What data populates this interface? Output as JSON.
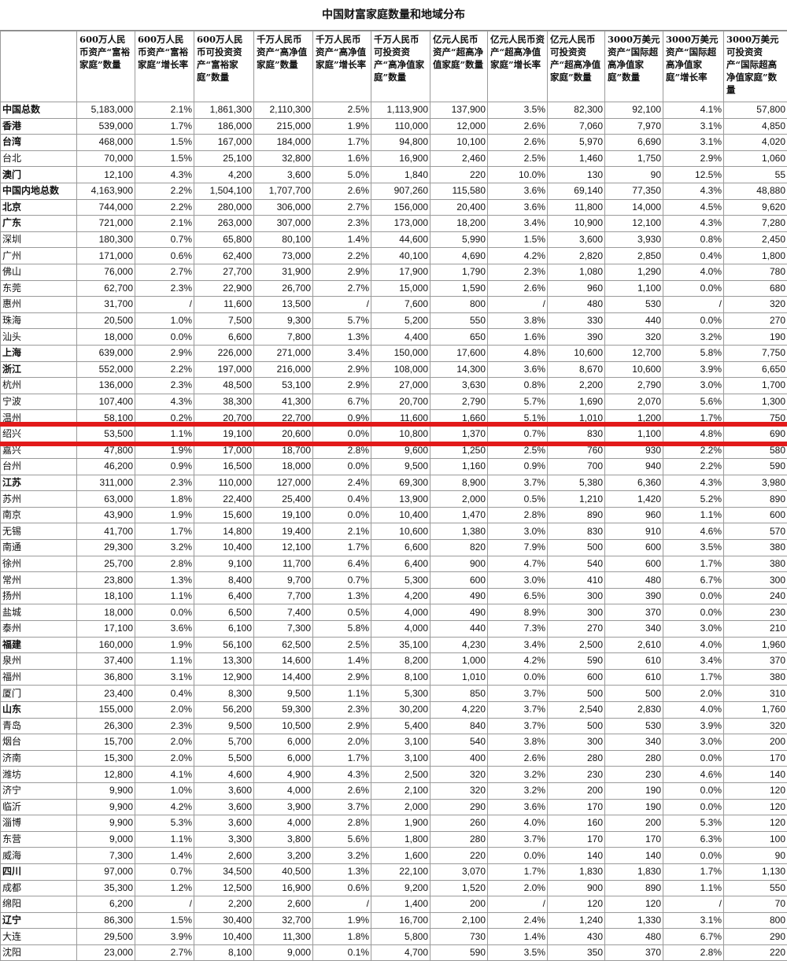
{
  "title": "中国财富家庭数量和地域分布",
  "headers": [
    "",
    "600万人民币资产“富裕家庭”数量",
    "600万人民币资产“富裕家庭”增长率",
    "600万人民币可投资资产“富裕家庭”数量",
    "千万人民币资产“高净值家庭”数量",
    "千万人民币资产“高净值家庭”增长率",
    "千万人民币可投资资产“高净值家庭”数量",
    "亿元人民币资产“超高净值家庭”数量",
    "亿元人民币资产“超高净值家庭”增长率",
    "亿元人民币可投资资产“超高净值家庭”数量",
    "3000万美元资产“国际超高净值家庭”数量",
    "3000万美元资产“国际超高净值家庭”增长率",
    "3000万美元可投资资产“国际超高净值家庭”数量"
  ],
  "highlight_color": "#e21a1a",
  "highlighted_region": "绍兴",
  "rows": [
    {
      "bold": true,
      "cells": [
        "中国总数",
        "5,183,000",
        "2.1%",
        "1,861,300",
        "2,110,300",
        "2.5%",
        "1,113,900",
        "137,900",
        "3.5%",
        "82,300",
        "92,100",
        "4.1%",
        "57,800"
      ]
    },
    {
      "bold": true,
      "cells": [
        "香港",
        "539,000",
        "1.7%",
        "186,000",
        "215,000",
        "1.9%",
        "110,000",
        "12,000",
        "2.6%",
        "7,060",
        "7,970",
        "3.1%",
        "4,850"
      ]
    },
    {
      "bold": true,
      "cells": [
        "台湾",
        "468,000",
        "1.5%",
        "167,000",
        "184,000",
        "1.7%",
        "94,800",
        "10,100",
        "2.6%",
        "5,970",
        "6,690",
        "3.1%",
        "4,020"
      ]
    },
    {
      "bold": false,
      "cells": [
        "台北",
        "70,000",
        "1.5%",
        "25,100",
        "32,800",
        "1.6%",
        "16,900",
        "2,460",
        "2.5%",
        "1,460",
        "1,750",
        "2.9%",
        "1,060"
      ]
    },
    {
      "bold": true,
      "cells": [
        "澳门",
        "12,100",
        "4.3%",
        "4,200",
        "3,600",
        "5.0%",
        "1,840",
        "220",
        "10.0%",
        "130",
        "90",
        "12.5%",
        "55"
      ]
    },
    {
      "bold": true,
      "cells": [
        "中国内地总数",
        "4,163,900",
        "2.2%",
        "1,504,100",
        "1,707,700",
        "2.6%",
        "907,260",
        "115,580",
        "3.6%",
        "69,140",
        "77,350",
        "4.3%",
        "48,880"
      ]
    },
    {
      "bold": true,
      "cells": [
        "北京",
        "744,000",
        "2.2%",
        "280,000",
        "306,000",
        "2.7%",
        "156,000",
        "20,400",
        "3.6%",
        "11,800",
        "14,000",
        "4.5%",
        "9,620"
      ]
    },
    {
      "bold": true,
      "cells": [
        "广东",
        "721,000",
        "2.1%",
        "263,000",
        "307,000",
        "2.3%",
        "173,000",
        "18,200",
        "3.4%",
        "10,900",
        "12,100",
        "4.3%",
        "7,280"
      ]
    },
    {
      "bold": false,
      "cells": [
        "深圳",
        "180,300",
        "0.7%",
        "65,800",
        "80,100",
        "1.4%",
        "44,600",
        "5,990",
        "1.5%",
        "3,600",
        "3,930",
        "0.8%",
        "2,450"
      ]
    },
    {
      "bold": false,
      "cells": [
        "广州",
        "171,000",
        "0.6%",
        "62,400",
        "73,000",
        "2.2%",
        "40,100",
        "4,690",
        "4.2%",
        "2,820",
        "2,850",
        "0.4%",
        "1,800"
      ]
    },
    {
      "bold": false,
      "cells": [
        "佛山",
        "76,000",
        "2.7%",
        "27,700",
        "31,900",
        "2.9%",
        "17,900",
        "1,790",
        "2.3%",
        "1,080",
        "1,290",
        "4.0%",
        "780"
      ]
    },
    {
      "bold": false,
      "cells": [
        "东莞",
        "62,700",
        "2.3%",
        "22,900",
        "26,700",
        "2.7%",
        "15,000",
        "1,590",
        "2.6%",
        "960",
        "1,100",
        "0.0%",
        "680"
      ]
    },
    {
      "bold": false,
      "cells": [
        "惠州",
        "31,700",
        "/",
        "11,600",
        "13,500",
        "/",
        "7,600",
        "800",
        "/",
        "480",
        "530",
        "/",
        "320"
      ]
    },
    {
      "bold": false,
      "cells": [
        "珠海",
        "20,500",
        "1.0%",
        "7,500",
        "9,300",
        "5.7%",
        "5,200",
        "550",
        "3.8%",
        "330",
        "440",
        "0.0%",
        "270"
      ]
    },
    {
      "bold": false,
      "cells": [
        "汕头",
        "18,000",
        "0.0%",
        "6,600",
        "7,800",
        "1.3%",
        "4,400",
        "650",
        "1.6%",
        "390",
        "320",
        "3.2%",
        "190"
      ]
    },
    {
      "bold": true,
      "cells": [
        "上海",
        "639,000",
        "2.9%",
        "226,000",
        "271,000",
        "3.4%",
        "150,000",
        "17,600",
        "4.8%",
        "10,600",
        "12,700",
        "5.8%",
        "7,750"
      ]
    },
    {
      "bold": true,
      "cells": [
        "浙江",
        "552,000",
        "2.2%",
        "197,000",
        "216,000",
        "2.9%",
        "108,000",
        "14,300",
        "3.6%",
        "8,670",
        "10,600",
        "3.9%",
        "6,650"
      ]
    },
    {
      "bold": false,
      "cells": [
        "杭州",
        "136,000",
        "2.3%",
        "48,500",
        "53,100",
        "2.9%",
        "27,000",
        "3,630",
        "0.8%",
        "2,200",
        "2,790",
        "3.0%",
        "1,700"
      ]
    },
    {
      "bold": false,
      "cells": [
        "宁波",
        "107,400",
        "4.3%",
        "38,300",
        "41,300",
        "6.7%",
        "20,700",
        "2,790",
        "5.7%",
        "1,690",
        "2,070",
        "5.6%",
        "1,300"
      ]
    },
    {
      "bold": false,
      "cells": [
        "温州",
        "58,100",
        "0.2%",
        "20,700",
        "22,700",
        "0.9%",
        "11,600",
        "1,660",
        "5.1%",
        "1,010",
        "1,200",
        "1.7%",
        "750"
      ]
    },
    {
      "bold": false,
      "cells": [
        "绍兴",
        "53,500",
        "1.1%",
        "19,100",
        "20,600",
        "0.0%",
        "10,800",
        "1,370",
        "0.7%",
        "830",
        "1,100",
        "4.8%",
        "690"
      ]
    },
    {
      "bold": false,
      "cells": [
        "嘉兴",
        "47,800",
        "1.9%",
        "17,000",
        "18,700",
        "2.8%",
        "9,600",
        "1,250",
        "2.5%",
        "760",
        "930",
        "2.2%",
        "580"
      ]
    },
    {
      "bold": false,
      "cells": [
        "台州",
        "46,200",
        "0.9%",
        "16,500",
        "18,000",
        "0.0%",
        "9,500",
        "1,160",
        "0.9%",
        "700",
        "940",
        "2.2%",
        "590"
      ]
    },
    {
      "bold": true,
      "cells": [
        "江苏",
        "311,000",
        "2.3%",
        "110,000",
        "127,000",
        "2.4%",
        "69,300",
        "8,900",
        "3.7%",
        "5,380",
        "6,360",
        "4.3%",
        "3,980"
      ]
    },
    {
      "bold": false,
      "cells": [
        "苏州",
        "63,000",
        "1.8%",
        "22,400",
        "25,400",
        "0.4%",
        "13,900",
        "2,000",
        "0.5%",
        "1,210",
        "1,420",
        "5.2%",
        "890"
      ]
    },
    {
      "bold": false,
      "cells": [
        "南京",
        "43,900",
        "1.9%",
        "15,600",
        "19,100",
        "0.0%",
        "10,400",
        "1,470",
        "2.8%",
        "890",
        "960",
        "1.1%",
        "600"
      ]
    },
    {
      "bold": false,
      "cells": [
        "无锡",
        "41,700",
        "1.7%",
        "14,800",
        "19,400",
        "2.1%",
        "10,600",
        "1,380",
        "3.0%",
        "830",
        "910",
        "4.6%",
        "570"
      ]
    },
    {
      "bold": false,
      "cells": [
        "南通",
        "29,300",
        "3.2%",
        "10,400",
        "12,100",
        "1.7%",
        "6,600",
        "820",
        "7.9%",
        "500",
        "600",
        "3.5%",
        "380"
      ]
    },
    {
      "bold": false,
      "cells": [
        "徐州",
        "25,700",
        "2.8%",
        "9,100",
        "11,700",
        "6.4%",
        "6,400",
        "900",
        "4.7%",
        "540",
        "600",
        "1.7%",
        "380"
      ]
    },
    {
      "bold": false,
      "cells": [
        "常州",
        "23,800",
        "1.3%",
        "8,400",
        "9,700",
        "0.7%",
        "5,300",
        "600",
        "3.0%",
        "410",
        "480",
        "6.7%",
        "300"
      ]
    },
    {
      "bold": false,
      "cells": [
        "扬州",
        "18,100",
        "1.1%",
        "6,400",
        "7,700",
        "1.3%",
        "4,200",
        "490",
        "6.5%",
        "300",
        "390",
        "0.0%",
        "240"
      ]
    },
    {
      "bold": false,
      "cells": [
        "盐城",
        "18,000",
        "0.0%",
        "6,500",
        "7,400",
        "0.5%",
        "4,000",
        "490",
        "8.9%",
        "300",
        "370",
        "0.0%",
        "230"
      ]
    },
    {
      "bold": false,
      "cells": [
        "泰州",
        "17,100",
        "3.6%",
        "6,100",
        "7,300",
        "5.8%",
        "4,000",
        "440",
        "7.3%",
        "270",
        "340",
        "3.0%",
        "210"
      ]
    },
    {
      "bold": true,
      "cells": [
        "福建",
        "160,000",
        "1.9%",
        "56,100",
        "62,500",
        "2.5%",
        "35,100",
        "4,230",
        "3.4%",
        "2,500",
        "2,610",
        "4.0%",
        "1,960"
      ]
    },
    {
      "bold": false,
      "cells": [
        "泉州",
        "37,400",
        "1.1%",
        "13,300",
        "14,600",
        "1.4%",
        "8,200",
        "1,000",
        "4.2%",
        "590",
        "610",
        "3.4%",
        "370"
      ]
    },
    {
      "bold": false,
      "cells": [
        "福州",
        "36,800",
        "3.1%",
        "12,900",
        "14,400",
        "2.9%",
        "8,100",
        "1,010",
        "0.0%",
        "600",
        "610",
        "1.7%",
        "380"
      ]
    },
    {
      "bold": false,
      "cells": [
        "厦门",
        "23,400",
        "0.4%",
        "8,300",
        "9,500",
        "1.1%",
        "5,300",
        "850",
        "3.7%",
        "500",
        "500",
        "2.0%",
        "310"
      ]
    },
    {
      "bold": true,
      "cells": [
        "山东",
        "155,000",
        "2.0%",
        "56,200",
        "59,300",
        "2.3%",
        "30,200",
        "4,220",
        "3.7%",
        "2,540",
        "2,830",
        "4.0%",
        "1,760"
      ]
    },
    {
      "bold": false,
      "cells": [
        "青岛",
        "26,300",
        "2.3%",
        "9,500",
        "10,500",
        "2.9%",
        "5,400",
        "840",
        "3.7%",
        "500",
        "530",
        "3.9%",
        "320"
      ]
    },
    {
      "bold": false,
      "cells": [
        "烟台",
        "15,700",
        "2.0%",
        "5,700",
        "6,000",
        "2.0%",
        "3,100",
        "540",
        "3.8%",
        "300",
        "340",
        "3.0%",
        "200"
      ]
    },
    {
      "bold": false,
      "cells": [
        "济南",
        "15,300",
        "2.0%",
        "5,500",
        "6,000",
        "1.7%",
        "3,100",
        "400",
        "2.6%",
        "280",
        "280",
        "0.0%",
        "170"
      ]
    },
    {
      "bold": false,
      "cells": [
        "潍坊",
        "12,800",
        "4.1%",
        "4,600",
        "4,900",
        "4.3%",
        "2,500",
        "320",
        "3.2%",
        "230",
        "230",
        "4.6%",
        "140"
      ]
    },
    {
      "bold": false,
      "cells": [
        "济宁",
        "9,900",
        "1.0%",
        "3,600",
        "4,000",
        "2.6%",
        "2,100",
        "320",
        "3.2%",
        "200",
        "190",
        "0.0%",
        "120"
      ]
    },
    {
      "bold": false,
      "cells": [
        "临沂",
        "9,900",
        "4.2%",
        "3,600",
        "3,900",
        "3.7%",
        "2,000",
        "290",
        "3.6%",
        "170",
        "190",
        "0.0%",
        "120"
      ]
    },
    {
      "bold": false,
      "cells": [
        "淄博",
        "9,900",
        "5.3%",
        "3,600",
        "4,000",
        "2.8%",
        "1,900",
        "260",
        "4.0%",
        "160",
        "200",
        "5.3%",
        "120"
      ]
    },
    {
      "bold": false,
      "cells": [
        "东营",
        "9,000",
        "1.1%",
        "3,300",
        "3,800",
        "5.6%",
        "1,800",
        "280",
        "3.7%",
        "170",
        "170",
        "6.3%",
        "100"
      ]
    },
    {
      "bold": false,
      "cells": [
        "威海",
        "7,300",
        "1.4%",
        "2,600",
        "3,200",
        "3.2%",
        "1,600",
        "220",
        "0.0%",
        "140",
        "140",
        "0.0%",
        "90"
      ]
    },
    {
      "bold": true,
      "cells": [
        "四川",
        "97,000",
        "0.7%",
        "34,500",
        "40,500",
        "1.3%",
        "22,100",
        "3,070",
        "1.7%",
        "1,830",
        "1,830",
        "1.7%",
        "1,130"
      ]
    },
    {
      "bold": false,
      "cells": [
        "成都",
        "35,300",
        "1.2%",
        "12,500",
        "16,900",
        "0.6%",
        "9,200",
        "1,520",
        "2.0%",
        "900",
        "890",
        "1.1%",
        "550"
      ]
    },
    {
      "bold": false,
      "cells": [
        "绵阳",
        "6,200",
        "/",
        "2,200",
        "2,600",
        "/",
        "1,400",
        "200",
        "/",
        "120",
        "120",
        "/",
        "70"
      ]
    },
    {
      "bold": true,
      "cells": [
        "辽宁",
        "86,300",
        "1.5%",
        "30,400",
        "32,700",
        "1.9%",
        "16,700",
        "2,100",
        "2.4%",
        "1,240",
        "1,330",
        "3.1%",
        "800"
      ]
    },
    {
      "bold": false,
      "cells": [
        "大连",
        "29,500",
        "3.9%",
        "10,400",
        "11,300",
        "1.8%",
        "5,800",
        "730",
        "1.4%",
        "430",
        "480",
        "6.7%",
        "290"
      ]
    },
    {
      "bold": false,
      "cells": [
        "沈阳",
        "23,000",
        "2.7%",
        "8,100",
        "9,000",
        "0.1%",
        "4,700",
        "590",
        "3.5%",
        "350",
        "370",
        "2.8%",
        "220"
      ]
    }
  ]
}
